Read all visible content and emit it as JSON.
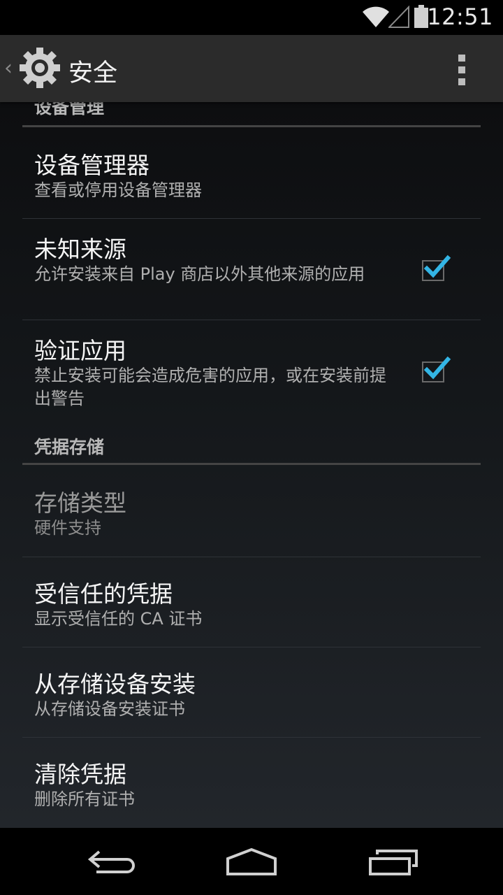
{
  "status_bar": {
    "time": "12:51"
  },
  "action_bar": {
    "title": "安全"
  },
  "sections": {
    "device_admin_header": "设备管理",
    "credential_storage_header": "凭据存储"
  },
  "items": {
    "device_admins": {
      "title": "设备管理器",
      "summary": "查看或停用设备管理器"
    },
    "unknown_sources": {
      "title": "未知来源",
      "summary": "允许安装来自 Play 商店以外其他来源的应用",
      "checked": true
    },
    "verify_apps": {
      "title": "验证应用",
      "summary": "禁止安装可能会造成危害的应用，或在安装前提出警告",
      "checked": true
    },
    "storage_type": {
      "title": "存储类型",
      "summary": "硬件支持"
    },
    "trusted_credentials": {
      "title": "受信任的凭据",
      "summary": "显示受信任的 CA 证书"
    },
    "install_from_storage": {
      "title": "从存储设备安装",
      "summary": "从存储设备安装证书"
    },
    "clear_credentials": {
      "title": "清除凭据",
      "summary": "删除所有证书"
    }
  },
  "colors": {
    "accent": "#33b5e5",
    "background": "#000000",
    "action_bar": "#2b2b2b"
  }
}
